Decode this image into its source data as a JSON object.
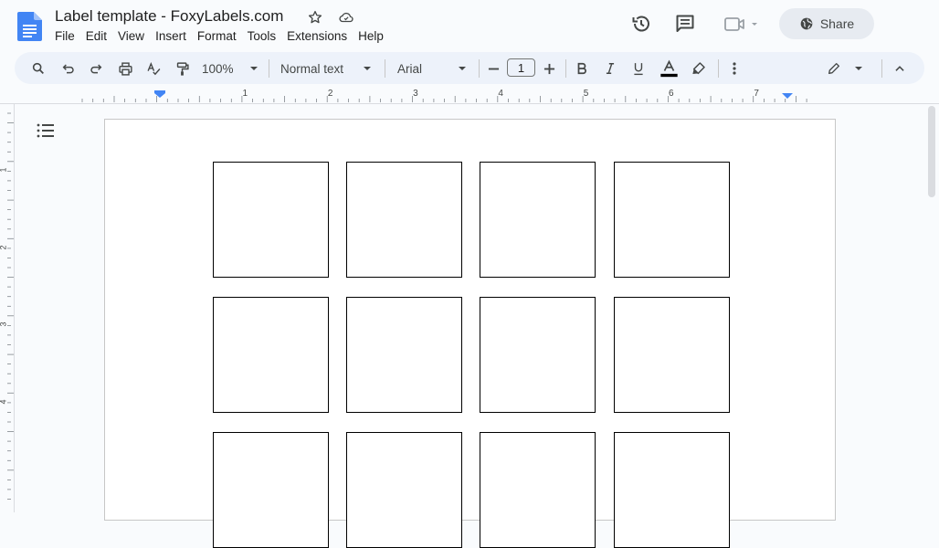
{
  "header": {
    "title": "Label template - FoxyLabels.com",
    "share_label": "Share"
  },
  "menu": [
    "File",
    "Edit",
    "View",
    "Insert",
    "Format",
    "Tools",
    "Extensions",
    "Help"
  ],
  "toolbar": {
    "zoom": "100%",
    "style": "Normal text",
    "font": "Arial",
    "font_size": "1"
  },
  "ruler": {
    "horizontal": [
      "1",
      "2",
      "3",
      "4",
      "5",
      "6",
      "7"
    ],
    "vertical": [
      "1",
      "2",
      "3",
      "4"
    ]
  },
  "labels": {
    "rows_visible": 3,
    "columns": 4
  },
  "colors": {
    "accent": "#4285f4",
    "doc_icon": "#4285f4",
    "toolbar_bg": "#edf2fa",
    "share_bg": "#e7ebf1"
  }
}
